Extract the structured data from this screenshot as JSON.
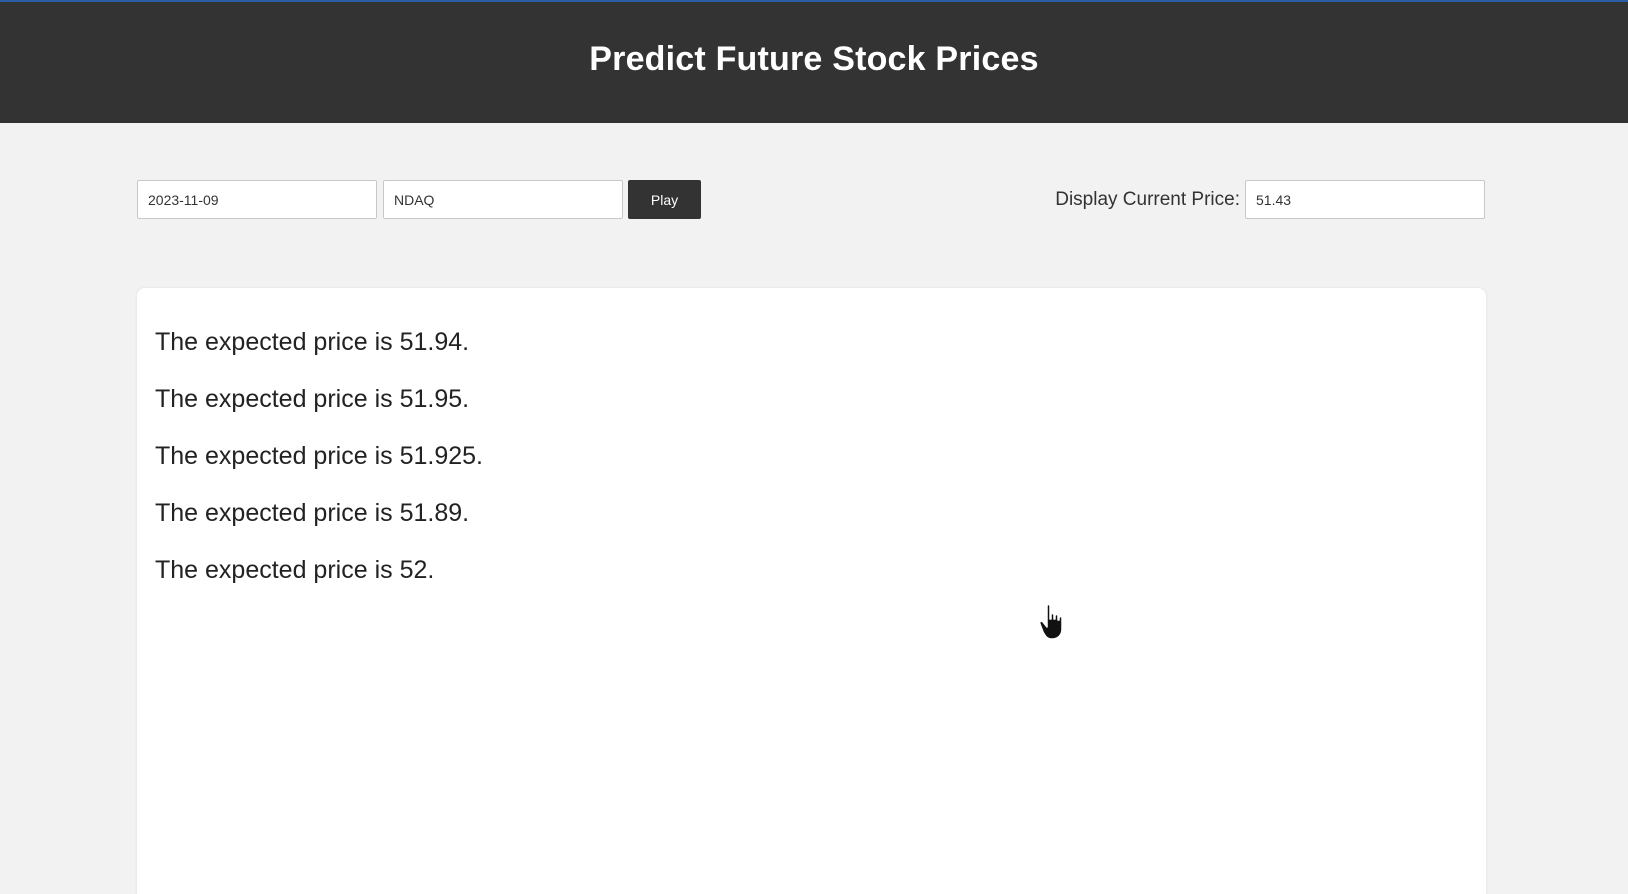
{
  "header": {
    "title": "Predict Future Stock Prices"
  },
  "form": {
    "date_value": "2023-11-09",
    "ticker_value": "NDAQ",
    "play_label": "Play",
    "current_price_label": "Display Current Price:",
    "current_price_value": "51.43"
  },
  "results": {
    "items": [
      "The expected price is 51.94.",
      "The expected price is 51.95.",
      "The expected price is 51.925.",
      "The expected price is 51.89.",
      "The expected price is 52."
    ]
  },
  "icons": {
    "cursor": "hand-pointer-icon"
  },
  "colors": {
    "header_bg": "#333333",
    "accent": "#2a5fa8",
    "page_bg": "#f2f2f2"
  }
}
